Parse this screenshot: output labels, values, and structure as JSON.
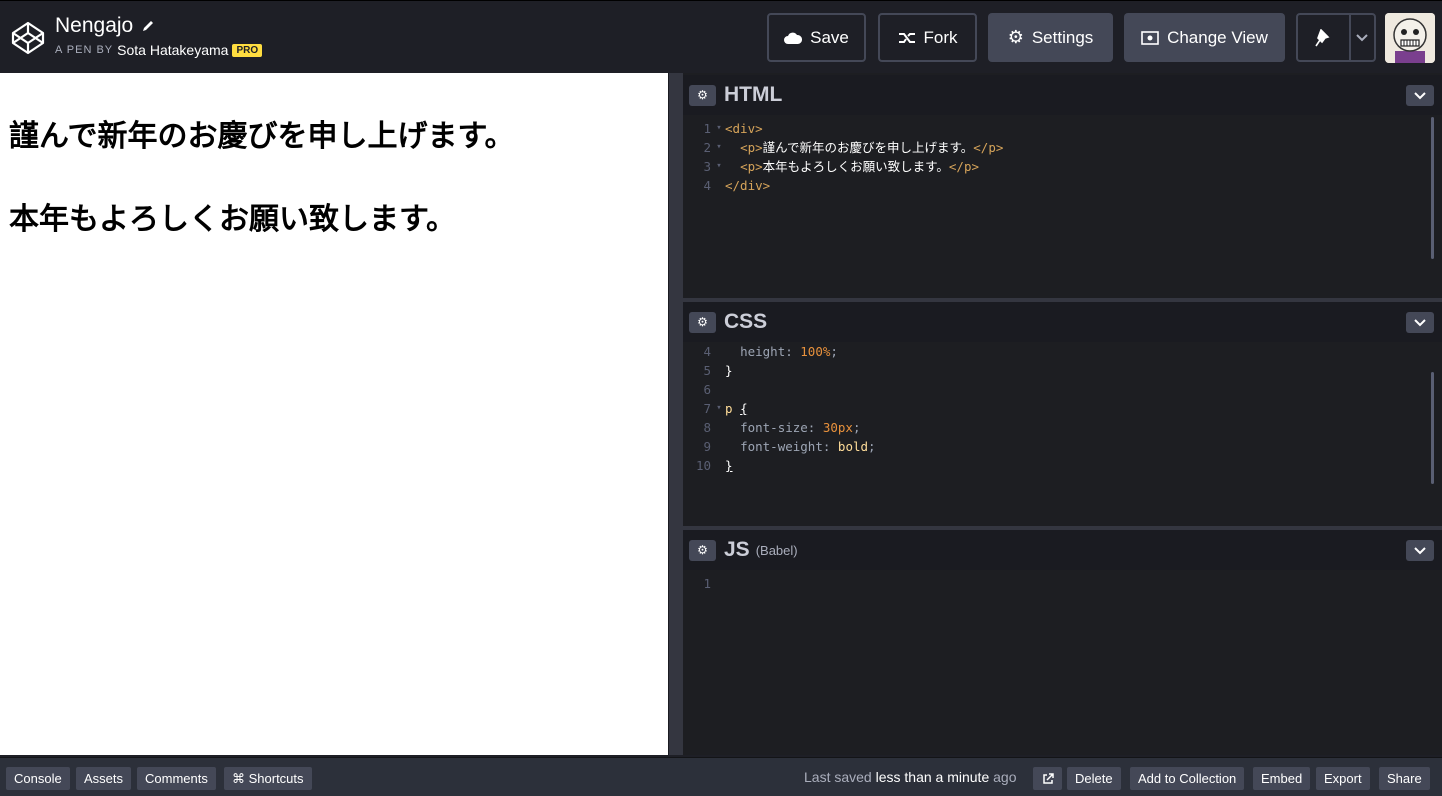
{
  "header": {
    "title": "Nengajo",
    "byline_prefix": "A PEN BY",
    "author": "Sota Hatakeyama",
    "badge": "PRO",
    "buttons": {
      "save": "Save",
      "fork": "Fork",
      "settings": "Settings",
      "change_view": "Change View"
    }
  },
  "preview": {
    "lines": [
      "謹んで新年のお慶びを申し上げます。",
      "本年もよろしくお願い致します。"
    ]
  },
  "html_pane": {
    "title": "HTML",
    "code": {
      "l1": "<div>",
      "l2_open": "<p>",
      "l2_text": "謹んで新年のお慶びを申し上げます。",
      "l2_close": "</p>",
      "l3_open": "<p>",
      "l3_text": "本年もよろしくお願い致します。",
      "l3_close": "</p>",
      "l4": "</div>"
    },
    "line_numbers": [
      "1",
      "2",
      "3",
      "4"
    ]
  },
  "css_pane": {
    "title": "CSS",
    "line_numbers": [
      "4",
      "5",
      "6",
      "7",
      "8",
      "9",
      "10"
    ],
    "code": {
      "l4_prop": "height",
      "l4_val": "100%",
      "l5": "}",
      "l7_sel": "p",
      "l7_brace": "{",
      "l8_prop": "font-size",
      "l8_val": "30px",
      "l9_prop": "font-weight",
      "l9_val": "bold",
      "l10": "}"
    }
  },
  "js_pane": {
    "title": "JS",
    "subtitle": "(Babel)",
    "line_numbers": [
      "1"
    ]
  },
  "footer": {
    "console": "Console",
    "assets": "Assets",
    "comments": "Comments",
    "shortcuts": "⌘ Shortcuts",
    "saved_prefix": "Last saved",
    "saved_time": "less than a minute",
    "saved_suffix": "ago",
    "delete": "Delete",
    "add_to_collection": "Add to Collection",
    "embed": "Embed",
    "export": "Export",
    "share": "Share"
  },
  "colors": {
    "background": "#1e1f26",
    "button": "#444857",
    "pro_badge": "#ffdd40"
  },
  "icons": [
    "codepen-logo-icon",
    "pencil-icon",
    "cloud-icon",
    "fork-icon",
    "gear-icon",
    "change-view-icon",
    "pin-icon",
    "chevron-down-icon",
    "external-link-icon"
  ]
}
